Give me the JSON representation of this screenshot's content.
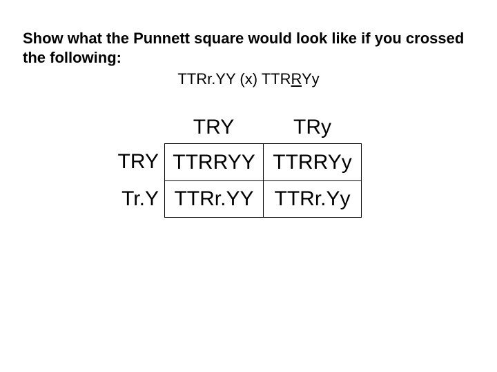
{
  "prompt": "Show what the Punnett square would look like if you crossed the following:",
  "cross": {
    "prefix": "TTRr.YY (x) TTR",
    "underlined": "R",
    "suffix": "Yy"
  },
  "punnett": {
    "col_headers": [
      "TRY",
      "TRy"
    ],
    "row_labels": [
      "TRY",
      "Tr.Y"
    ],
    "cells": [
      [
        "TTRRYY",
        "TTRRYy"
      ],
      [
        "TTRr.YY",
        "TTRr.Yy"
      ]
    ]
  }
}
